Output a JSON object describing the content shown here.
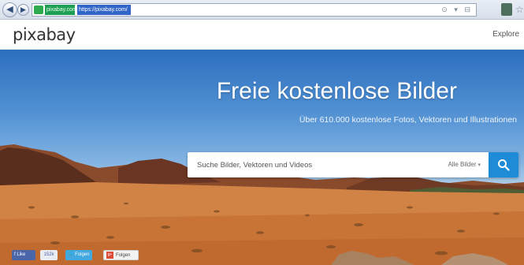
{
  "browser": {
    "back_glyph": "◀",
    "forward_glyph": "▶",
    "tab_title": "pixabay.com",
    "url": "https://pixabay.com/",
    "address_icons": "⊙ ▾ ⊟",
    "star_glyph": "☆",
    "icons": [
      "back-icon",
      "forward-icon",
      "favicon",
      "home-icon",
      "star-icon"
    ]
  },
  "header": {
    "logo": "pixabay",
    "explore_label": "Explore"
  },
  "hero": {
    "title": "Freie kostenlose Bilder",
    "subtitle": "Über 610.000 kostenlose Fotos, Vektoren und Illustrationen"
  },
  "search": {
    "placeholder": "Suche Bilder, Vektoren und Videos",
    "type_label": "Alle Bilder",
    "type_chevron": "▾",
    "button_icon": "search-icon"
  },
  "social": {
    "fb_like": "f Like",
    "fb_count": "152k",
    "twitter": "🐦 Folgen",
    "gplus_badge": "g+",
    "gplus": "Folgen"
  },
  "colors": {
    "accent": "#1d8bd6",
    "facebook": "#4a66a8",
    "twitter": "#41a8e0",
    "sky_top": "#2c6fbd",
    "sand": "#c9763a"
  }
}
